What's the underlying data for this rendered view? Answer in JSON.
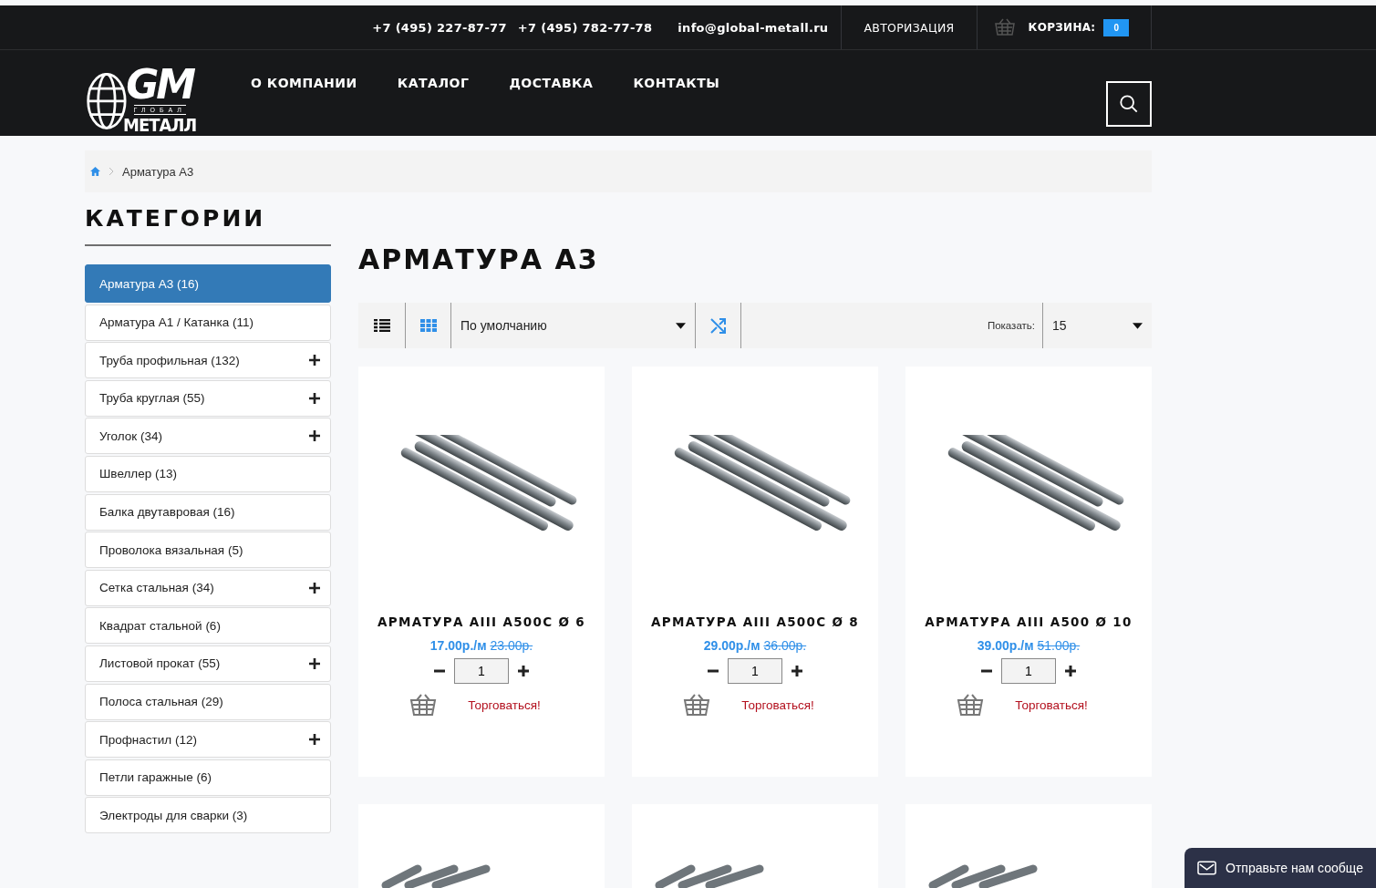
{
  "top_bar": {
    "phones": [
      "+7 (495) 227-87-77",
      "+7 (495) 782-77-78"
    ],
    "email": "info@global-metall.ru",
    "login": "АВТОРИЗАЦИЯ",
    "cart_label": "КОРЗИНА:",
    "cart_count": "0"
  },
  "logo": {
    "mark": "GM",
    "top": "ГЛОБАЛ",
    "bottom": "МЕТАЛЛ"
  },
  "nav": [
    "О КОМПАНИИ",
    "КАТАЛОГ",
    "ДОСТАВКА",
    "КОНТАКТЫ"
  ],
  "breadcrumb": [
    "Арматура А3"
  ],
  "sidebar": {
    "title": "КАТЕГОРИИ",
    "items": [
      {
        "label": "Арматура А3 (16)",
        "selected": true,
        "expandable": false
      },
      {
        "label": "Арматура А1 / Катанка (11)",
        "selected": false,
        "expandable": false
      },
      {
        "label": "Труба профильная (132)",
        "selected": false,
        "expandable": true
      },
      {
        "label": "Труба круглая (55)",
        "selected": false,
        "expandable": true
      },
      {
        "label": "Уголок (34)",
        "selected": false,
        "expandable": true
      },
      {
        "label": "Швеллер (13)",
        "selected": false,
        "expandable": false
      },
      {
        "label": "Балка двутавровая (16)",
        "selected": false,
        "expandable": false
      },
      {
        "label": "Проволока вязальная (5)",
        "selected": false,
        "expandable": false
      },
      {
        "label": "Сетка стальная (34)",
        "selected": false,
        "expandable": true
      },
      {
        "label": "Квадрат стальной (6)",
        "selected": false,
        "expandable": false
      },
      {
        "label": "Листовой прокат (55)",
        "selected": false,
        "expandable": true
      },
      {
        "label": "Полоса стальная (29)",
        "selected": false,
        "expandable": false
      },
      {
        "label": "Профнастил (12)",
        "selected": false,
        "expandable": true
      },
      {
        "label": "Петли гаражные (6)",
        "selected": false,
        "expandable": false
      },
      {
        "label": "Электроды для сварки (3)",
        "selected": false,
        "expandable": false
      }
    ]
  },
  "page_title": "АРМАТУРА А3",
  "toolbar": {
    "views": [
      {
        "kind": "list",
        "selected": false
      },
      {
        "kind": "grid",
        "selected": true
      }
    ],
    "sort": "По умолчанию",
    "limit_label": "Показать:",
    "limit": "15"
  },
  "products": [
    {
      "kind": "full",
      "name": "АРМАТУРА AIII A500C Ø 6",
      "price": "17.00р./м",
      "old_price": "23.00р.",
      "quantity": "1",
      "bargain": "Торговаться!"
    },
    {
      "kind": "full",
      "name": "АРМАТУРА AIII A500C Ø 8",
      "price": "29.00р./м",
      "old_price": "36.00р.",
      "quantity": "1",
      "bargain": "Торговаться!"
    },
    {
      "kind": "full",
      "name": "АРМАТУРА AIII A500 Ø 10",
      "price": "39.00р./м",
      "old_price": "51.00р.",
      "quantity": "1",
      "bargain": "Торговаться!"
    },
    {
      "kind": "image_only"
    },
    {
      "kind": "image_only"
    },
    {
      "kind": "image_only"
    }
  ],
  "chat": {
    "label": "Отправьте нам сообще"
  }
}
